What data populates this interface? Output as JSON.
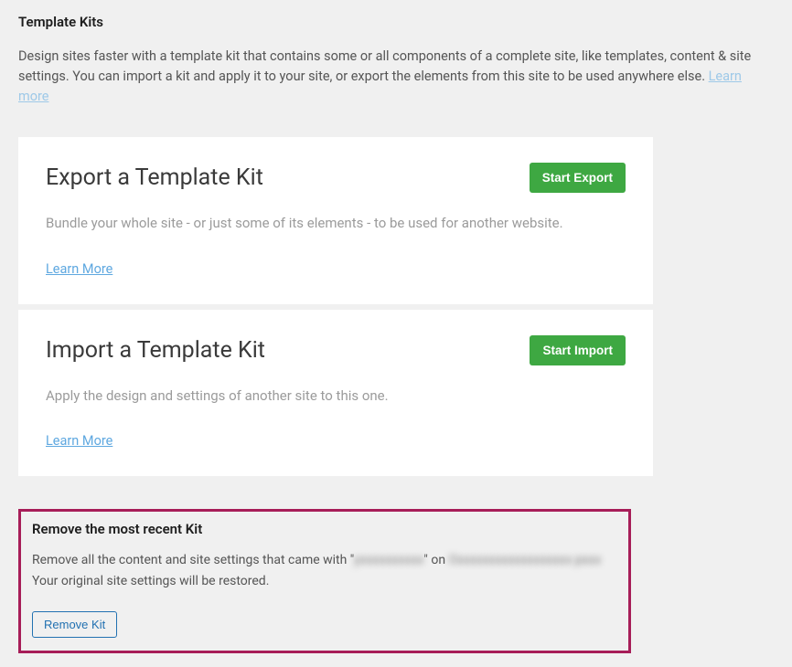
{
  "header": {
    "title": "Template Kits",
    "description_part1": "Design sites faster with a template kit that contains some or all components of a complete site, like templates, content & site settings. You can import a kit and apply it to your site, or export the elements from this site to be used anywhere else. ",
    "learn_more": "Learn more"
  },
  "export_card": {
    "title": "Export a Template Kit",
    "button": "Start Export",
    "description": "Bundle your whole site - or just some of its elements - to be used for another website.",
    "learn_more": "Learn More"
  },
  "import_card": {
    "title": "Import a Template Kit",
    "button": "Start Import",
    "description": "Apply the design and settings of another site to this one.",
    "learn_more": "Learn More"
  },
  "remove_panel": {
    "title": "Remove the most recent Kit",
    "description_pre": "Remove all the content and site settings that came with \"",
    "redacted_name": "yxxxxxxxxxx",
    "description_mid": "\" on ",
    "redacted_date": "Oxxxxxxxxxxxxxxxxxx pxxx",
    "description_post": "Your original site settings will be restored.",
    "button": "Remove Kit"
  }
}
